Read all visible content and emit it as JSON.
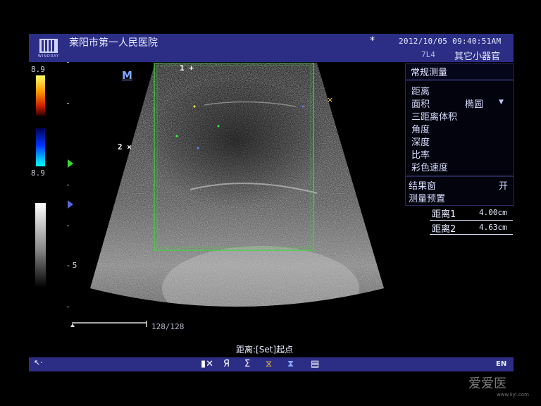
{
  "header": {
    "hospital": "莱阳市第一人民医院",
    "logo_text": "WINDRAY",
    "datetime": "2012/10/05 09:40:51AM",
    "probe": "7L4",
    "exam": "其它小器官",
    "snow_icon": "*"
  },
  "left_panel": {
    "color_scale_top": "8.9",
    "color_scale_bottom": "8.9",
    "depth_label": "- 5",
    "frame_count": "128/128"
  },
  "image": {
    "mode_mark": "M",
    "caliper_1": "1 +",
    "caliper_2": "2 ×"
  },
  "menu": {
    "title": "常规测量",
    "items": [
      "距离",
      "面积",
      "三距离体积",
      "角度",
      "深度",
      "比率",
      "彩色速度"
    ],
    "area_option": "椭圆",
    "results_label": "结果窗",
    "results_value": "开",
    "preset_label": "测量预置"
  },
  "measurements": [
    {
      "name": "距离1",
      "value": "4.00cm"
    },
    {
      "name": "距离2",
      "value": "4.63cm"
    }
  ],
  "status": {
    "prompt": "距离:[Set]起点"
  },
  "bottom": {
    "icons": [
      "▮✕",
      "Я",
      "Ʃ",
      "⧖",
      "⧗",
      "▤"
    ],
    "lang": "EN"
  },
  "watermark": {
    "text": "爱爱医",
    "url": "www.iiyi.com"
  },
  "colors": {
    "header_bg": "#2c2e86",
    "roi_green": "#33dd33",
    "panel_border": "#26285a"
  }
}
